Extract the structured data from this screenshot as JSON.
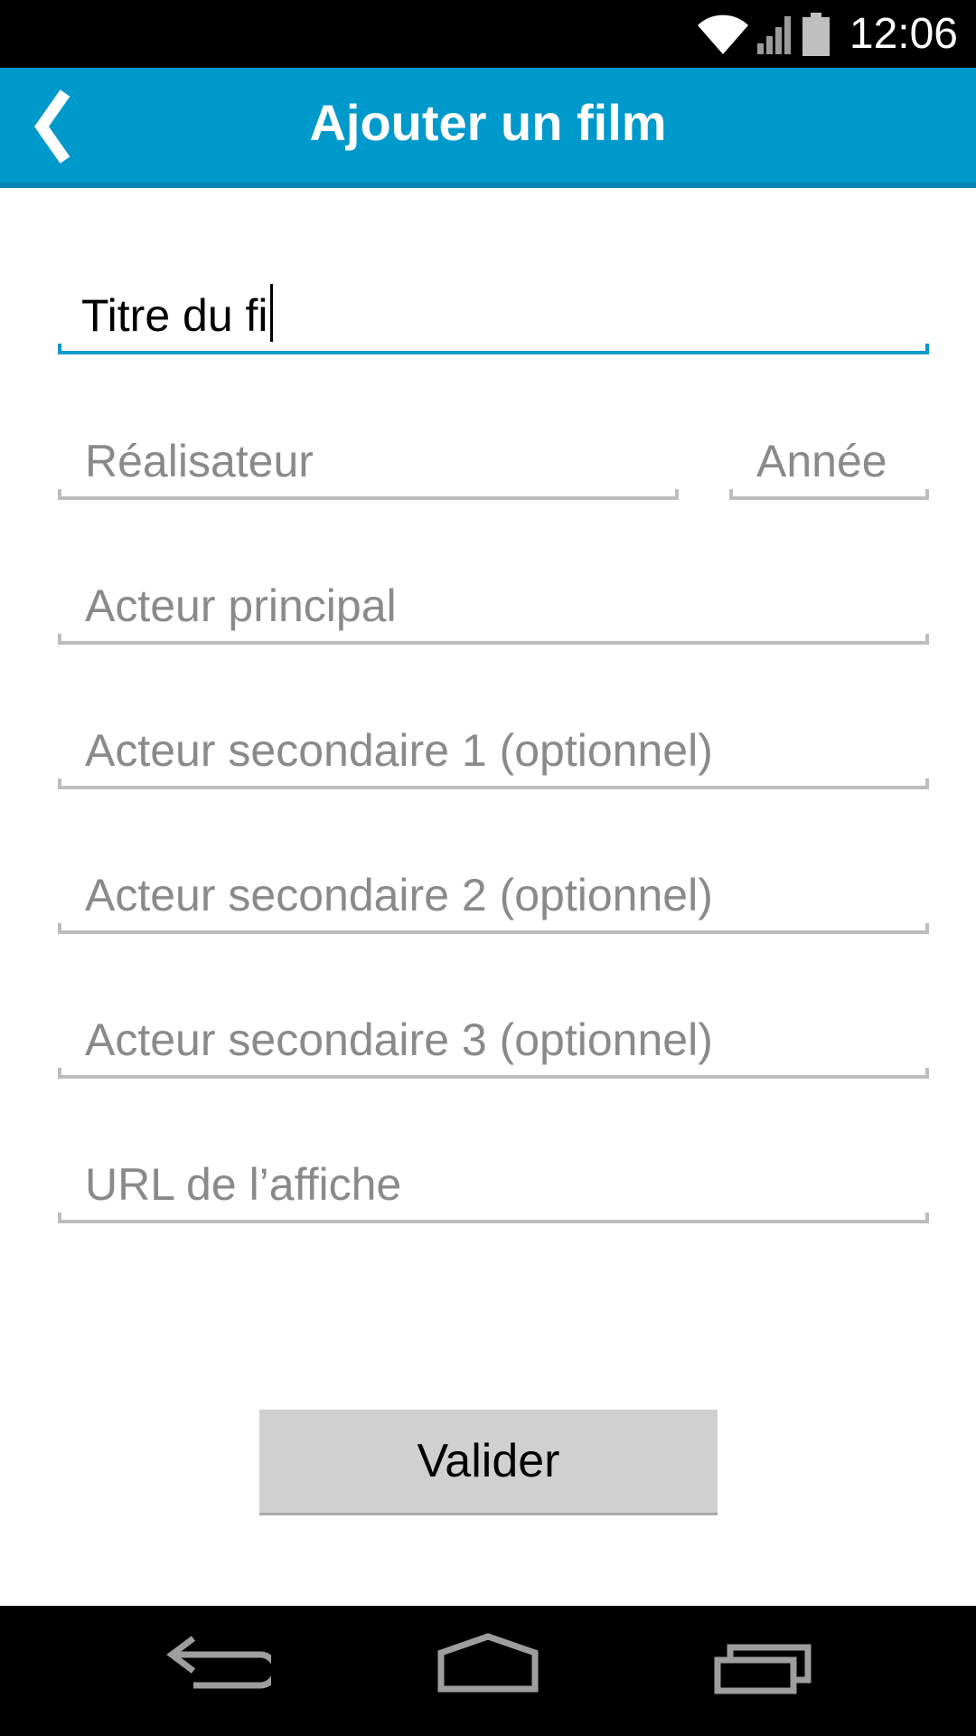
{
  "status_bar": {
    "time": "12:06",
    "icons": [
      "wifi-icon",
      "signal-icon",
      "battery-icon"
    ]
  },
  "action_bar": {
    "title": "Ajouter un film",
    "back_icon": "chevron-left-icon",
    "color": "#0099cc"
  },
  "form": {
    "title_value": "Titre du fi",
    "director_placeholder": "Réalisateur",
    "year_placeholder": "Année",
    "lead_actor_placeholder": "Acteur principal",
    "actor2_placeholder": "Acteur secondaire 1 (optionnel)",
    "actor3_placeholder": "Acteur secondaire 2 (optionnel)",
    "actor4_placeholder": "Acteur secondaire 3 (optionnel)",
    "poster_url_placeholder": "URL de l’affiche"
  },
  "button": {
    "label": "Valider"
  },
  "nav_bar": {
    "icons": [
      "back-nav-icon",
      "home-icon",
      "recent-apps-icon"
    ]
  }
}
